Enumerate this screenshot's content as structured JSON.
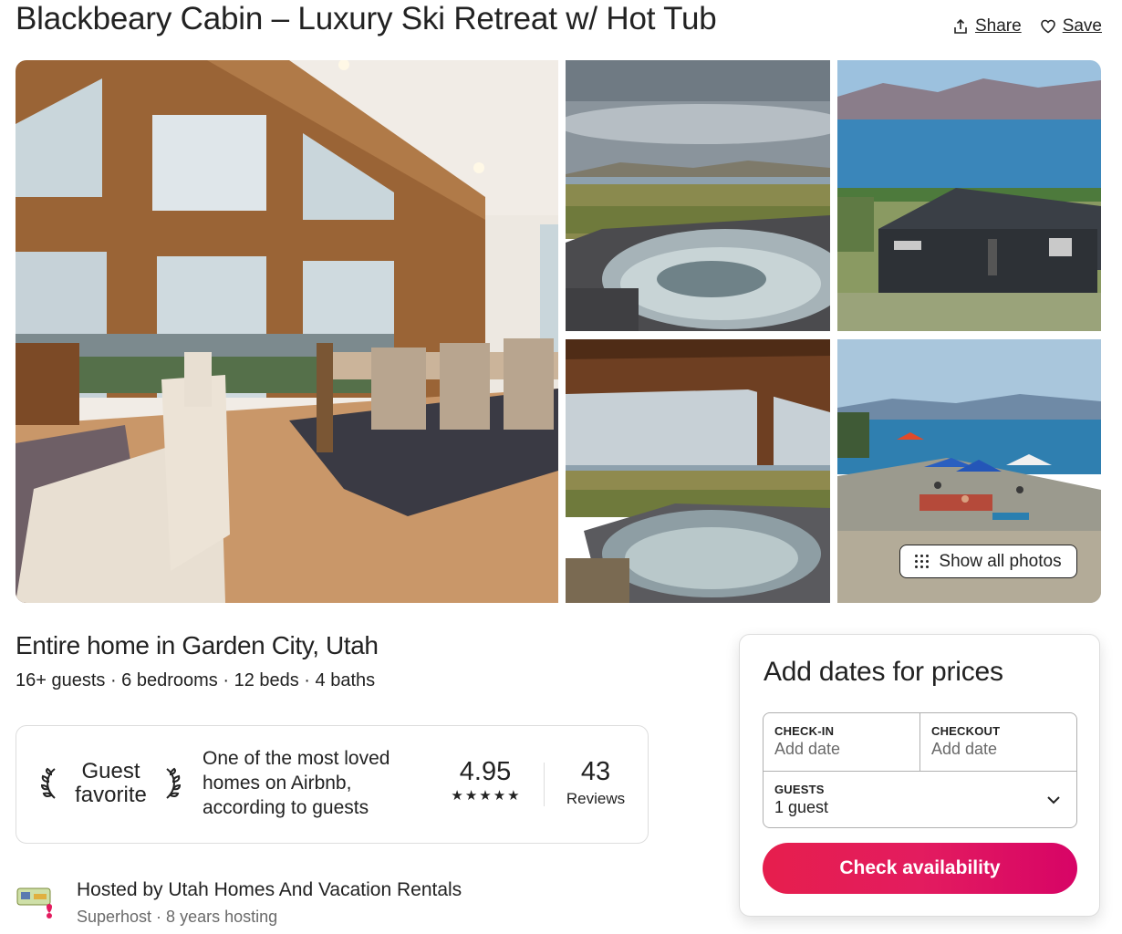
{
  "header": {
    "title": "Blackbeary Cabin – Luxury Ski Retreat w/ Hot Tub",
    "share_label": "Share",
    "save_label": "Save"
  },
  "gallery": {
    "photos": [
      "living-room",
      "hot-tub-lake-view",
      "house-lake-view",
      "covered-hot-tub",
      "lake-beach"
    ],
    "show_all_label": "Show all photos"
  },
  "overview": {
    "title": "Entire home in Garden City, Utah",
    "details": "16+ guests · 6 bedrooms · 12 beds · 4 baths"
  },
  "guest_favorite": {
    "badge_line1": "Guest",
    "badge_line2": "favorite",
    "description": "One of the most loved homes on Airbnb, according to guests",
    "rating": "4.95",
    "stars": 5,
    "reviews_count": "43",
    "reviews_label": "Reviews"
  },
  "host": {
    "name": "Hosted by Utah Homes And Vacation Rentals",
    "meta": "Superhost · 8 years hosting"
  },
  "booking": {
    "title": "Add dates for prices",
    "checkin_label": "CHECK-IN",
    "checkin_value": "Add date",
    "checkout_label": "CHECKOUT",
    "checkout_value": "Add date",
    "guests_label": "GUESTS",
    "guests_value": "1 guest",
    "button_label": "Check availability"
  },
  "colors": {
    "brand": "#e31c5f",
    "text": "#222222",
    "muted": "#6a6a6a",
    "border": "#dddddd"
  }
}
